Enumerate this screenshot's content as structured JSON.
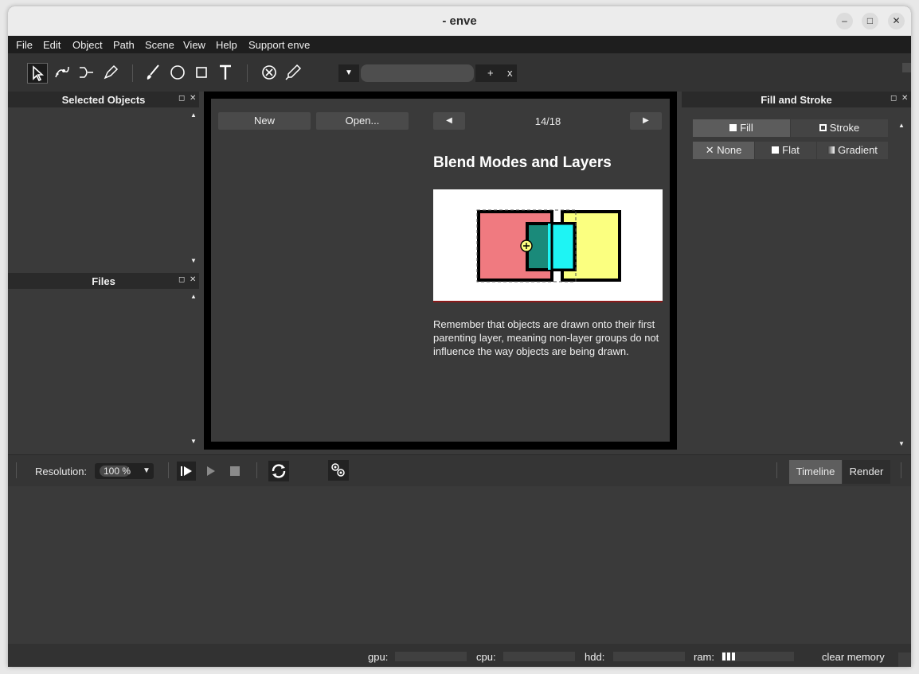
{
  "window": {
    "title": "- enve"
  },
  "menu": [
    "File",
    "Edit",
    "Object",
    "Path",
    "Scene",
    "View",
    "Help",
    "Support enve"
  ],
  "toolbar": {
    "tools": [
      "cursor-icon",
      "node-icon",
      "path-edit-icon",
      "pen-icon",
      "brush-icon",
      "circle-icon",
      "rectangle-icon",
      "text-icon",
      "cancel-icon",
      "color-picker-icon"
    ],
    "plus": "+",
    "close": "x"
  },
  "panels": {
    "selected_objects": "Selected Objects",
    "files": "Files",
    "fill_stroke": "Fill and Stroke"
  },
  "welcome": {
    "new_btn": "New",
    "open_btn": "Open...",
    "page": "14/18",
    "tip_title": "Blend Modes and Layers",
    "tip_text": "Remember that objects are drawn onto their first parenting layer, meaning non-layer groups do not influence the way objects are being drawn."
  },
  "fill_stroke": {
    "tabs": [
      "Fill",
      "Stroke"
    ],
    "paint_types": [
      "None",
      "Flat",
      "Gradient"
    ]
  },
  "playback": {
    "resolution_label": "Resolution:",
    "resolution_value": "100 %"
  },
  "bottom_tabs": [
    "Timeline",
    "Render"
  ],
  "status": {
    "gpu": "gpu:",
    "cpu": "cpu:",
    "hdd": "hdd:",
    "ram": "ram:",
    "clear": "clear memory"
  }
}
